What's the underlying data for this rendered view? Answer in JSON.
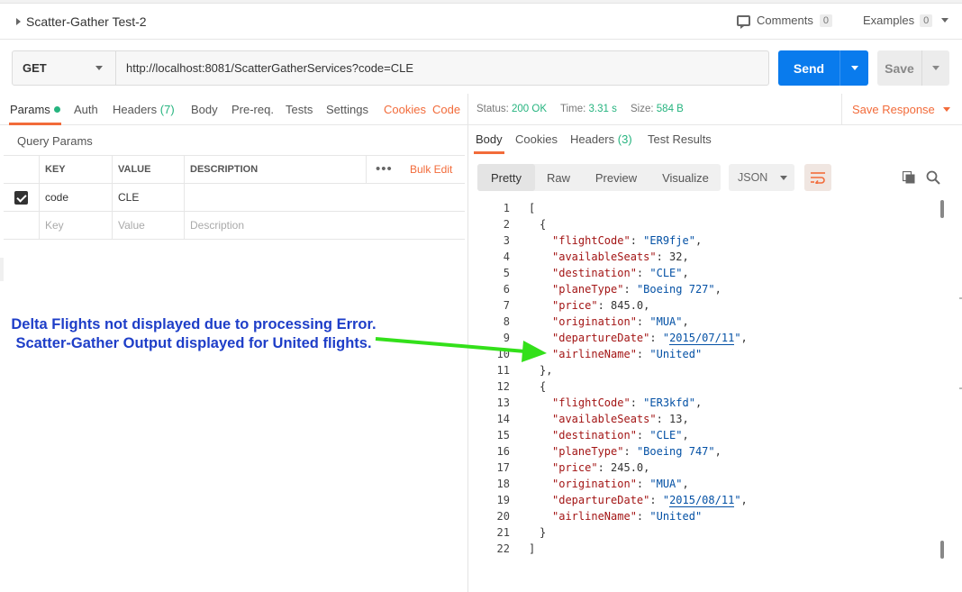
{
  "request": {
    "title": "Scatter-Gather Test-2",
    "comments_label": "Comments",
    "comments_count": "0",
    "examples_label": "Examples",
    "examples_count": "0",
    "method": "GET",
    "url": "http://localhost:8081/ScatterGatherServices?code=CLE",
    "send_label": "Send",
    "save_label": "Save"
  },
  "request_tabs": {
    "params": "Params",
    "auth": "Auth",
    "headers": "Headers",
    "headers_count": "(7)",
    "body": "Body",
    "prereq": "Pre-req.",
    "tests": "Tests",
    "settings": "Settings",
    "cookies": "Cookies",
    "code": "Code"
  },
  "query_params": {
    "title": "Query Params",
    "headers": {
      "key": "KEY",
      "value": "VALUE",
      "description": "DESCRIPTION"
    },
    "bulk_edit": "Bulk Edit",
    "rows": [
      {
        "key": "code",
        "value": "CLE",
        "description": ""
      }
    ],
    "placeholders": {
      "key": "Key",
      "value": "Value",
      "description": "Description"
    }
  },
  "response": {
    "status_label": "Status:",
    "status_value": "200 OK",
    "time_label": "Time:",
    "time_value": "3.31 s",
    "size_label": "Size:",
    "size_value": "584 B",
    "save_response": "Save Response"
  },
  "response_tabs": {
    "body": "Body",
    "cookies": "Cookies",
    "headers": "Headers",
    "headers_count": "(3)",
    "test_results": "Test Results"
  },
  "view_modes": [
    "Pretty",
    "Raw",
    "Preview",
    "Visualize"
  ],
  "format": "JSON",
  "json_body": [
    {
      "airlineName": "United",
      "flightCode": "ER9fje",
      "availableSeats": "32",
      "destination": "CLE",
      "planeType": "Boeing 727",
      "price": "845.0",
      "origination": "MUA",
      "departureDate": "2015/07/11"
    },
    {
      "airlineName": "United",
      "flightCode": "ER3kfd",
      "availableSeats": "13",
      "destination": "CLE",
      "planeType": "Boeing 747",
      "price": "245.0",
      "origination": "MUA",
      "departureDate": "2015/08/11"
    }
  ],
  "annotation": {
    "line1": "Delta Flights not displayed due to processing Error.",
    "line2": "Scatter-Gather Output displayed for United flights.",
    "text_color": "#1e3ec8",
    "arrow_color": "#33e01a"
  },
  "colors": {
    "accent": "#f26b3a",
    "send": "#097bed",
    "success": "#26b47f"
  }
}
